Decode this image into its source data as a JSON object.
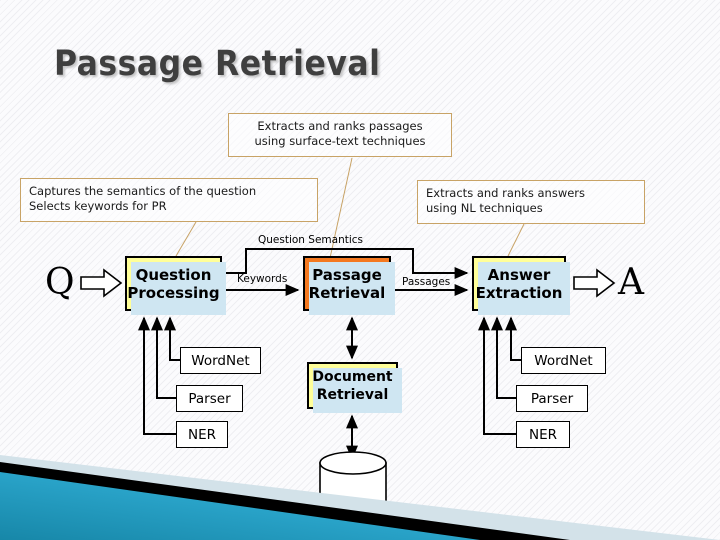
{
  "slide": {
    "title": "Passage Retrieval",
    "accent_color": "#f47920",
    "box_fill_color": "#ffff99",
    "note_border_color": "#c8a366",
    "shadow_color": "#cfe6f2",
    "corner_colors": [
      "#1b9fc4",
      "#000000",
      "#cfe0e8"
    ]
  },
  "notes": {
    "top": "Extracts and ranks passages\nusing surface-text techniques",
    "top_line1": "Extracts and ranks passages",
    "top_line2": "using surface-text techniques",
    "left_line1": "Captures the semantics of the question",
    "left_line2": "Selects keywords for PR",
    "right_line1": "Extracts and ranks answers",
    "right_line2": "using NL techniques"
  },
  "pipeline": {
    "input_glyph": "Q",
    "output_glyph": "A",
    "stages": [
      {
        "id": "question-processing",
        "line1": "Question",
        "line2": "Processing",
        "fill": "#ffff99"
      },
      {
        "id": "passage-retrieval",
        "line1": "Passage",
        "line2": "Retrieval",
        "fill": "#f47920"
      },
      {
        "id": "answer-extraction",
        "line1": "Answer",
        "line2": "Extraction",
        "fill": "#ffff99"
      }
    ],
    "document_retrieval": {
      "line1": "Document",
      "line2": "Retrieval",
      "fill": "#ffff99"
    },
    "edge_labels": {
      "question_semantics": "Question Semantics",
      "keywords": "Keywords",
      "passages": "Passages"
    }
  },
  "resources": {
    "left": [
      "WordNet",
      "Parser",
      "NER"
    ],
    "right": [
      "WordNet",
      "Parser",
      "NER"
    ]
  },
  "datastore": {
    "shape": "cylinder",
    "label": ""
  }
}
